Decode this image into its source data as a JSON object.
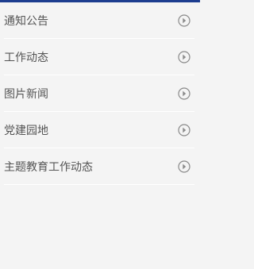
{
  "colors": {
    "accent_bar": "#1d3d8f",
    "background": "#f4f4f4",
    "text": "#555555",
    "divider": "#ffffff",
    "icon": "#8a8a8a"
  },
  "menu": {
    "items": [
      {
        "label": "通知公告",
        "icon": "chevron-circle-right-icon"
      },
      {
        "label": "工作动态",
        "icon": "chevron-circle-right-icon"
      },
      {
        "label": "图片新闻",
        "icon": "chevron-circle-right-icon"
      },
      {
        "label": "党建园地",
        "icon": "chevron-circle-right-icon"
      },
      {
        "label": "主题教育工作动态",
        "icon": "chevron-circle-right-icon"
      }
    ]
  }
}
